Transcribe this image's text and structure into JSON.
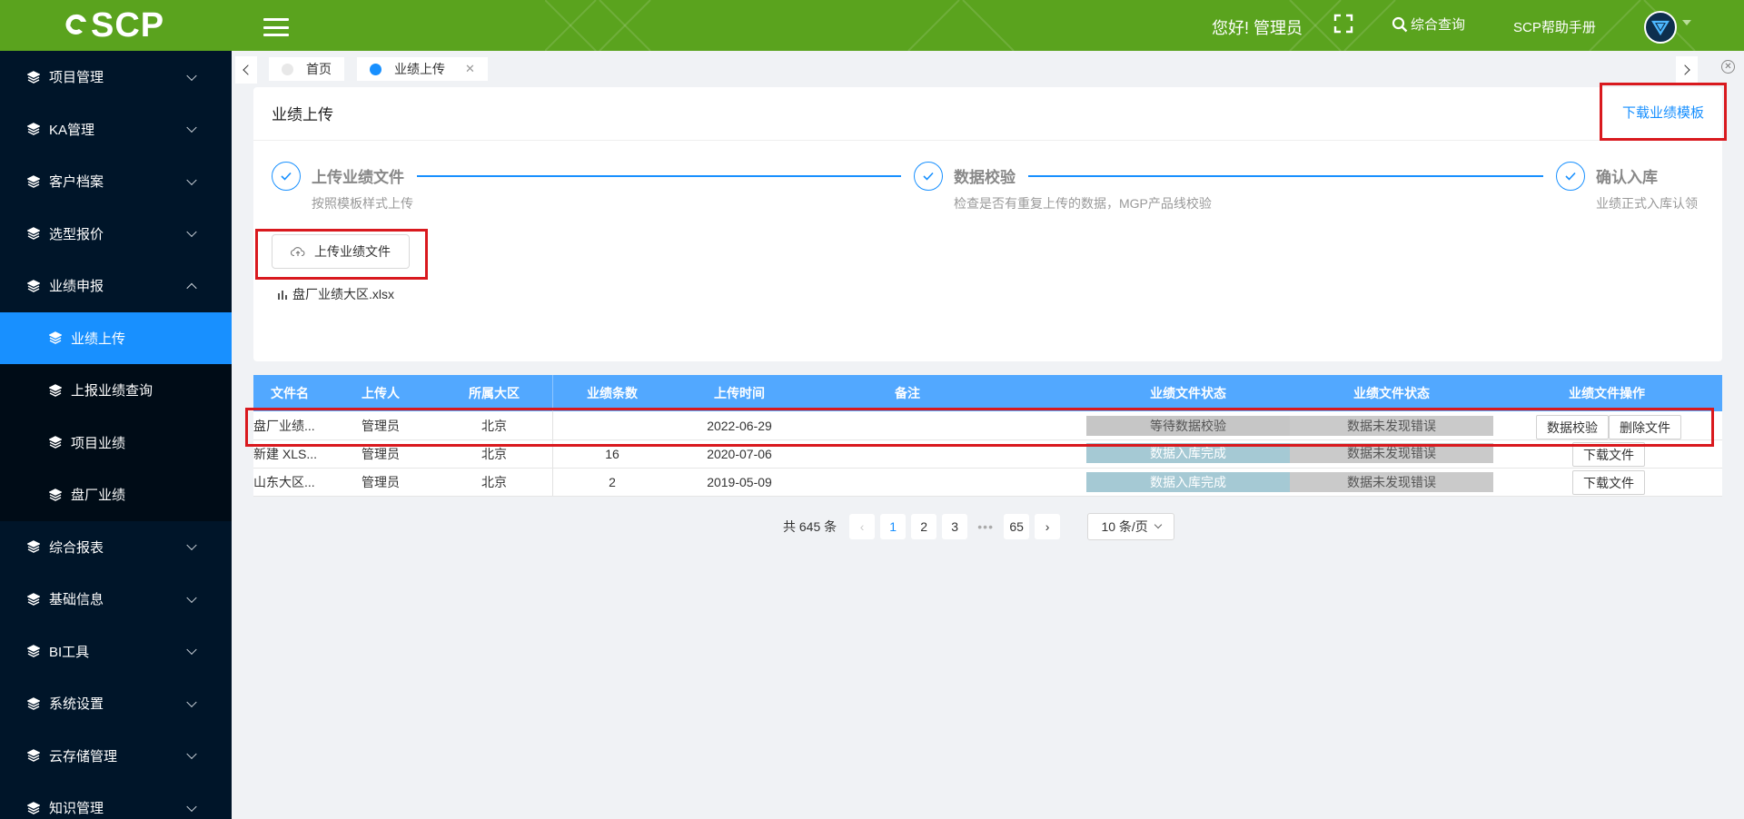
{
  "header": {
    "logo_text": "SCP",
    "greeting": "您好! 管理员",
    "search_label": "综合查询",
    "help_label": "SCP帮助手册",
    "background": "#5aa31e"
  },
  "sidebar": {
    "top_items": [
      {
        "label": "项目管理"
      },
      {
        "label": "KA管理"
      },
      {
        "label": "客户档案"
      },
      {
        "label": "选型报价"
      },
      {
        "label": "业绩申报"
      }
    ],
    "sub_items": [
      {
        "label": "业绩上传"
      },
      {
        "label": "上报业绩查询"
      },
      {
        "label": "项目业绩"
      },
      {
        "label": "盘厂业绩"
      }
    ],
    "bottom_items": [
      {
        "label": "综合报表"
      },
      {
        "label": "基础信息"
      },
      {
        "label": "BI工具"
      },
      {
        "label": "系统设置"
      },
      {
        "label": "云存储管理"
      },
      {
        "label": "知识管理"
      }
    ]
  },
  "tabs": [
    {
      "label": "首页"
    },
    {
      "label": "业绩上传"
    }
  ],
  "upload": {
    "title": "业绩上传",
    "download_link": "下载业绩模板",
    "steps": [
      {
        "title": "上传业绩文件",
        "desc": "按照模板样式上传"
      },
      {
        "title": "数据校验",
        "desc": "检查是否有重复上传的数据，MGP产品线校验"
      },
      {
        "title": "确认入库",
        "desc": "业绩正式入库认领"
      }
    ],
    "upload_button": "上传业绩文件",
    "file_name": "盘厂业绩大区.xlsx"
  },
  "table": {
    "columns": [
      "文件名",
      "上传人",
      "所属大区",
      "业绩条数",
      "上传时间",
      "备注",
      "业绩文件状态",
      "业绩文件状态",
      "业绩文件操作"
    ],
    "rows": [
      {
        "file": "盘厂业绩...",
        "uploader": "管理员",
        "region": "北京",
        "count": "",
        "time": "2022-06-29",
        "note": "",
        "status1": "等待数据校验",
        "status2": "数据未发现错误",
        "op1": "数据校验",
        "op2": "删除文件"
      },
      {
        "file": "新建 XLS...",
        "uploader": "管理员",
        "region": "北京",
        "count": "16",
        "time": "2020-07-06",
        "note": "",
        "status1": "数据入库完成",
        "status2": "数据未发现错误",
        "op1": "下载文件"
      },
      {
        "file": "山东大区...",
        "uploader": "管理员",
        "region": "北京",
        "count": "2",
        "time": "2019-05-09",
        "note": "",
        "status1": "数据入库完成",
        "status2": "数据未发现错误",
        "op1": "下载文件"
      }
    ]
  },
  "pagination": {
    "total": "共 645 条",
    "pages": [
      "1",
      "2",
      "3"
    ],
    "ellipsis": "•••",
    "last": "65",
    "page_size": "10 条/页",
    "current": "1"
  },
  "colors": {
    "accent": "#1890ff",
    "sidebar_bg": "#001529",
    "highlight": "#d9191e"
  }
}
